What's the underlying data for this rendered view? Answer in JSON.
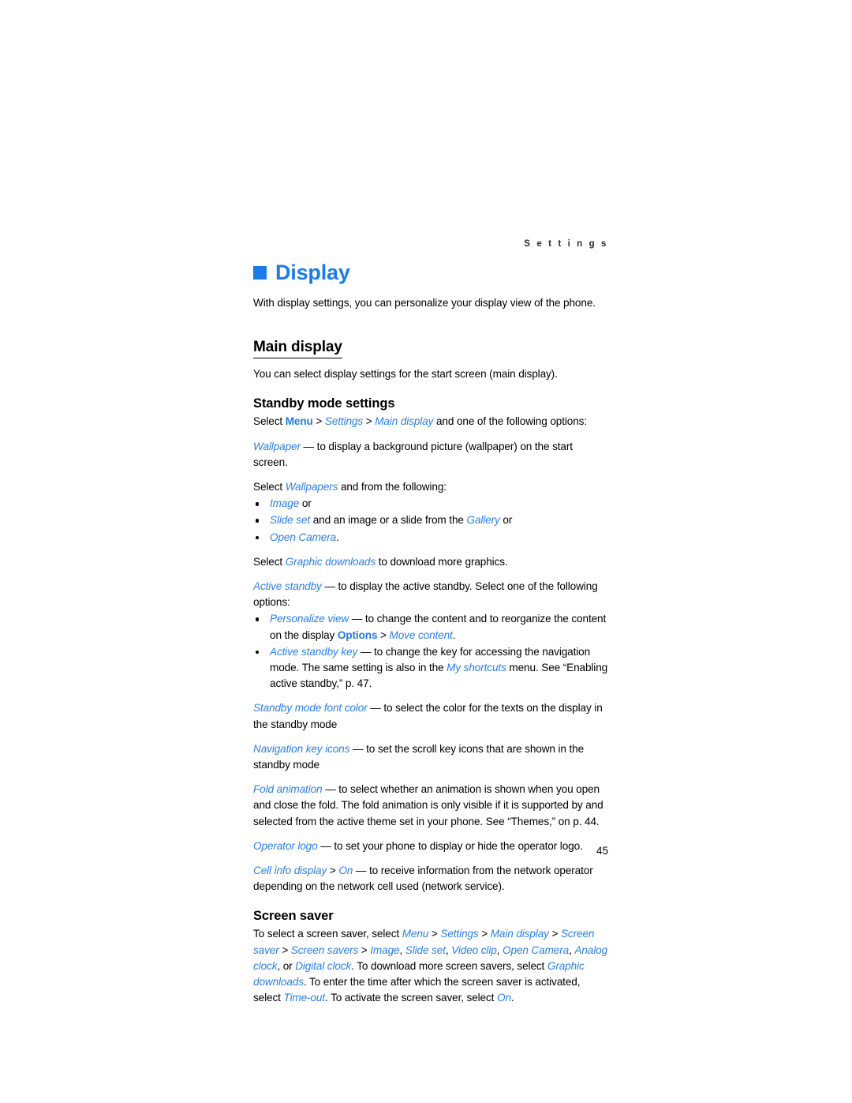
{
  "running_header": "S e t t i n g s",
  "chapter": {
    "square_color": "#1b7ce8",
    "title": "Display",
    "intro": "With display settings, you can personalize your display view of the phone."
  },
  "main_display": {
    "heading": "Main display",
    "intro": "You can select display settings for the start screen (main display)."
  },
  "standby": {
    "heading": "Standby mode settings",
    "line_select_prefix": "Select ",
    "menu": "Menu",
    "gt1": " > ",
    "settings": "Settings",
    "gt2": " > ",
    "main_display": "Main display",
    "line_select_suffix": " and one of the following options:",
    "wallpaper_term": "Wallpaper",
    "wallpaper_desc": " — to display a background picture (wallpaper) on the start screen.",
    "select_wallpapers_prefix": "Select ",
    "wallpapers_term": "Wallpapers",
    "select_wallpapers_suffix": " and from the following:",
    "bullet_image_term": "Image",
    "bullet_image_suffix": " or",
    "bullet_slideset_term": "Slide set",
    "bullet_slideset_mid": " and an image or a slide from the ",
    "bullet_slideset_gallery": "Gallery",
    "bullet_slideset_suffix": " or",
    "bullet_opencamera_term": "Open Camera",
    "bullet_opencamera_suffix": ".",
    "graphic_prefix": "Select ",
    "graphic_term": "Graphic downloads",
    "graphic_suffix": " to download more graphics.",
    "active_standby_term": "Active standby",
    "active_standby_desc": " — to display the active standby. Select one of the following options:",
    "bullet_personalize_term": "Personalize view",
    "bullet_personalize_desc": " — to change the content and to reorganize the content on the display ",
    "bullet_personalize_options": "Options",
    "bullet_personalize_gt": " > ",
    "bullet_personalize_move": "Move content",
    "bullet_personalize_end": ".",
    "bullet_askey_term": "Active standby key",
    "bullet_askey_desc": " — to change the key for accessing the navigation mode. The same setting is also in the ",
    "bullet_askey_shortcuts": "My shortcuts",
    "bullet_askey_end": " menu. See “Enabling active standby,” p. 47.",
    "font_color_term": "Standby mode font color",
    "font_color_desc": " — to select the color for the texts on the display in the standby mode",
    "nav_icons_term": "Navigation key icons",
    "nav_icons_desc": " — to set the scroll key icons that are shown in the standby mode",
    "fold_term": "Fold animation",
    "fold_desc": " — to select whether an animation is shown when you open and close the fold. The fold animation is only visible if it is supported by and selected from the active theme set in your phone. See “Themes,” on p. 44.",
    "operator_term": "Operator logo",
    "operator_desc": " — to set your phone to display or hide the operator logo.",
    "cellinfo_term": "Cell info display",
    "cellinfo_gt": " > ",
    "cellinfo_on": "On",
    "cellinfo_desc": " — to receive information from the network operator depending on the network cell used (network service)."
  },
  "screen_saver": {
    "heading": "Screen saver",
    "p_prefix": "To select a screen saver, select ",
    "menu": "Menu",
    "gt1": " > ",
    "settings": "Settings",
    "gt2": " > ",
    "main_display": "Main display",
    "gt3": " > ",
    "screen_saver": "Screen saver",
    "gt4": " > ",
    "screen_savers": "Screen savers",
    "gt5": " > ",
    "opt_image": "Image",
    "c1": ", ",
    "opt_slideset": "Slide set",
    "c2": ", ",
    "opt_videoclip": "Video clip",
    "c3": ", ",
    "opt_opencamera": "Open Camera",
    "c4": ", ",
    "opt_analogclock": "Analog clock",
    "c5": ", or ",
    "opt_digitalclock": "Digital clock",
    "mid1": ". To download more screen savers, select ",
    "graphic_downloads": "Graphic downloads",
    "mid2": ". To enter the time after which the screen saver is activated, select ",
    "timeout": "Time-out",
    "mid3": ". To activate the screen saver, select ",
    "on": "On",
    "end": "."
  },
  "page_number": "45"
}
